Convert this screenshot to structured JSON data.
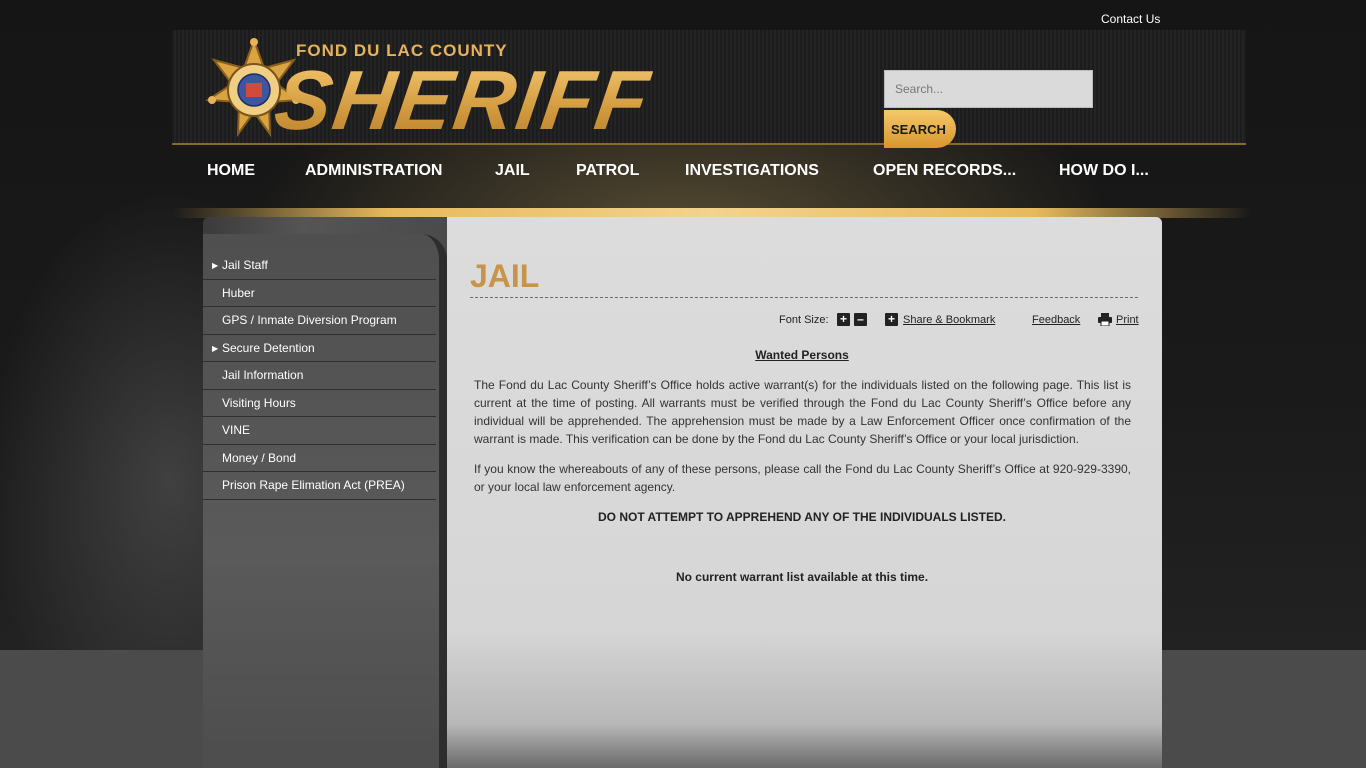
{
  "header": {
    "contact_label": "Contact Us",
    "county_label": "FOND DU LAC COUNTY",
    "logo_text": "SHERIFF",
    "search_placeholder": "Search...",
    "search_button": "SEARCH"
  },
  "nav": {
    "items": [
      {
        "label": "HOME"
      },
      {
        "label": "ADMINISTRATION"
      },
      {
        "label": "JAIL"
      },
      {
        "label": "PATROL"
      },
      {
        "label": "INVESTIGATIONS"
      },
      {
        "label": "OPEN RECORDS..."
      },
      {
        "label": "HOW DO I..."
      }
    ]
  },
  "sidebar": {
    "items": [
      {
        "label": "Jail Staff",
        "has_children": true
      },
      {
        "label": "Huber",
        "has_children": false
      },
      {
        "label": "GPS / Inmate Diversion Program",
        "has_children": false
      },
      {
        "label": "Secure Detention",
        "has_children": true
      },
      {
        "label": "Jail Information",
        "has_children": false
      },
      {
        "label": "Visiting Hours",
        "has_children": false
      },
      {
        "label": "VINE",
        "has_children": false
      },
      {
        "label": "Money / Bond",
        "has_children": false
      },
      {
        "label": "Prison Rape Elimation Act (PREA)",
        "has_children": false
      }
    ]
  },
  "main": {
    "title": "JAIL",
    "toolbar": {
      "font_size_label": "Font Size:",
      "share_label": "Share & Bookmark",
      "feedback_label": "Feedback",
      "print_label": "Print"
    },
    "heading": "Wanted Persons",
    "paragraph1": "The Fond du Lac County Sheriff’s Office holds active warrant(s) for the individuals listed on the following page. This list is current at the time of posting. All warrants must be verified through the Fond du Lac County Sheriff’s Office before any individual will be apprehended. The apprehension must be made by a Law Enforcement Officer once confirmation of the warrant is made. This verification can be done by the Fond du Lac County Sheriff’s Office or your local jurisdiction.",
    "paragraph2": "If you know the whereabouts of any of these persons, please call the Fond du Lac County Sheriff’s Office at 920-929-3390, or your local law enforcement agency.",
    "warning": "DO NOT ATTEMPT TO APPREHEND ANY OF THE INDIVIDUALS LISTED.",
    "no_list": "No current warrant list available at this time."
  },
  "colors": {
    "accent_gold": "#e1a84c",
    "title_gold": "#c7944a",
    "background": "#141414"
  },
  "icons": {
    "star": "sheriff-badge-icon",
    "plus": "plus-icon",
    "minus": "minus-icon",
    "share": "share-plus-icon",
    "print": "printer-icon",
    "arrow": "triangle-right-icon"
  }
}
